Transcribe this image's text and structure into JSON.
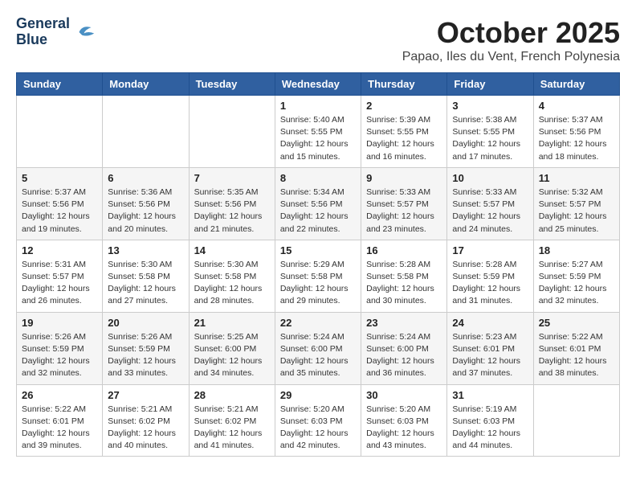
{
  "header": {
    "logo_line1": "General",
    "logo_line2": "Blue",
    "title": "October 2025",
    "location": "Papao, Iles du Vent, French Polynesia"
  },
  "days_of_week": [
    "Sunday",
    "Monday",
    "Tuesday",
    "Wednesday",
    "Thursday",
    "Friday",
    "Saturday"
  ],
  "weeks": [
    [
      {
        "day": "",
        "info": ""
      },
      {
        "day": "",
        "info": ""
      },
      {
        "day": "",
        "info": ""
      },
      {
        "day": "1",
        "info": "Sunrise: 5:40 AM\nSunset: 5:55 PM\nDaylight: 12 hours and 15 minutes."
      },
      {
        "day": "2",
        "info": "Sunrise: 5:39 AM\nSunset: 5:55 PM\nDaylight: 12 hours and 16 minutes."
      },
      {
        "day": "3",
        "info": "Sunrise: 5:38 AM\nSunset: 5:55 PM\nDaylight: 12 hours and 17 minutes."
      },
      {
        "day": "4",
        "info": "Sunrise: 5:37 AM\nSunset: 5:56 PM\nDaylight: 12 hours and 18 minutes."
      }
    ],
    [
      {
        "day": "5",
        "info": "Sunrise: 5:37 AM\nSunset: 5:56 PM\nDaylight: 12 hours and 19 minutes."
      },
      {
        "day": "6",
        "info": "Sunrise: 5:36 AM\nSunset: 5:56 PM\nDaylight: 12 hours and 20 minutes."
      },
      {
        "day": "7",
        "info": "Sunrise: 5:35 AM\nSunset: 5:56 PM\nDaylight: 12 hours and 21 minutes."
      },
      {
        "day": "8",
        "info": "Sunrise: 5:34 AM\nSunset: 5:56 PM\nDaylight: 12 hours and 22 minutes."
      },
      {
        "day": "9",
        "info": "Sunrise: 5:33 AM\nSunset: 5:57 PM\nDaylight: 12 hours and 23 minutes."
      },
      {
        "day": "10",
        "info": "Sunrise: 5:33 AM\nSunset: 5:57 PM\nDaylight: 12 hours and 24 minutes."
      },
      {
        "day": "11",
        "info": "Sunrise: 5:32 AM\nSunset: 5:57 PM\nDaylight: 12 hours and 25 minutes."
      }
    ],
    [
      {
        "day": "12",
        "info": "Sunrise: 5:31 AM\nSunset: 5:57 PM\nDaylight: 12 hours and 26 minutes."
      },
      {
        "day": "13",
        "info": "Sunrise: 5:30 AM\nSunset: 5:58 PM\nDaylight: 12 hours and 27 minutes."
      },
      {
        "day": "14",
        "info": "Sunrise: 5:30 AM\nSunset: 5:58 PM\nDaylight: 12 hours and 28 minutes."
      },
      {
        "day": "15",
        "info": "Sunrise: 5:29 AM\nSunset: 5:58 PM\nDaylight: 12 hours and 29 minutes."
      },
      {
        "day": "16",
        "info": "Sunrise: 5:28 AM\nSunset: 5:58 PM\nDaylight: 12 hours and 30 minutes."
      },
      {
        "day": "17",
        "info": "Sunrise: 5:28 AM\nSunset: 5:59 PM\nDaylight: 12 hours and 31 minutes."
      },
      {
        "day": "18",
        "info": "Sunrise: 5:27 AM\nSunset: 5:59 PM\nDaylight: 12 hours and 32 minutes."
      }
    ],
    [
      {
        "day": "19",
        "info": "Sunrise: 5:26 AM\nSunset: 5:59 PM\nDaylight: 12 hours and 32 minutes."
      },
      {
        "day": "20",
        "info": "Sunrise: 5:26 AM\nSunset: 5:59 PM\nDaylight: 12 hours and 33 minutes."
      },
      {
        "day": "21",
        "info": "Sunrise: 5:25 AM\nSunset: 6:00 PM\nDaylight: 12 hours and 34 minutes."
      },
      {
        "day": "22",
        "info": "Sunrise: 5:24 AM\nSunset: 6:00 PM\nDaylight: 12 hours and 35 minutes."
      },
      {
        "day": "23",
        "info": "Sunrise: 5:24 AM\nSunset: 6:00 PM\nDaylight: 12 hours and 36 minutes."
      },
      {
        "day": "24",
        "info": "Sunrise: 5:23 AM\nSunset: 6:01 PM\nDaylight: 12 hours and 37 minutes."
      },
      {
        "day": "25",
        "info": "Sunrise: 5:22 AM\nSunset: 6:01 PM\nDaylight: 12 hours and 38 minutes."
      }
    ],
    [
      {
        "day": "26",
        "info": "Sunrise: 5:22 AM\nSunset: 6:01 PM\nDaylight: 12 hours and 39 minutes."
      },
      {
        "day": "27",
        "info": "Sunrise: 5:21 AM\nSunset: 6:02 PM\nDaylight: 12 hours and 40 minutes."
      },
      {
        "day": "28",
        "info": "Sunrise: 5:21 AM\nSunset: 6:02 PM\nDaylight: 12 hours and 41 minutes."
      },
      {
        "day": "29",
        "info": "Sunrise: 5:20 AM\nSunset: 6:03 PM\nDaylight: 12 hours and 42 minutes."
      },
      {
        "day": "30",
        "info": "Sunrise: 5:20 AM\nSunset: 6:03 PM\nDaylight: 12 hours and 43 minutes."
      },
      {
        "day": "31",
        "info": "Sunrise: 5:19 AM\nSunset: 6:03 PM\nDaylight: 12 hours and 44 minutes."
      },
      {
        "day": "",
        "info": ""
      }
    ]
  ]
}
